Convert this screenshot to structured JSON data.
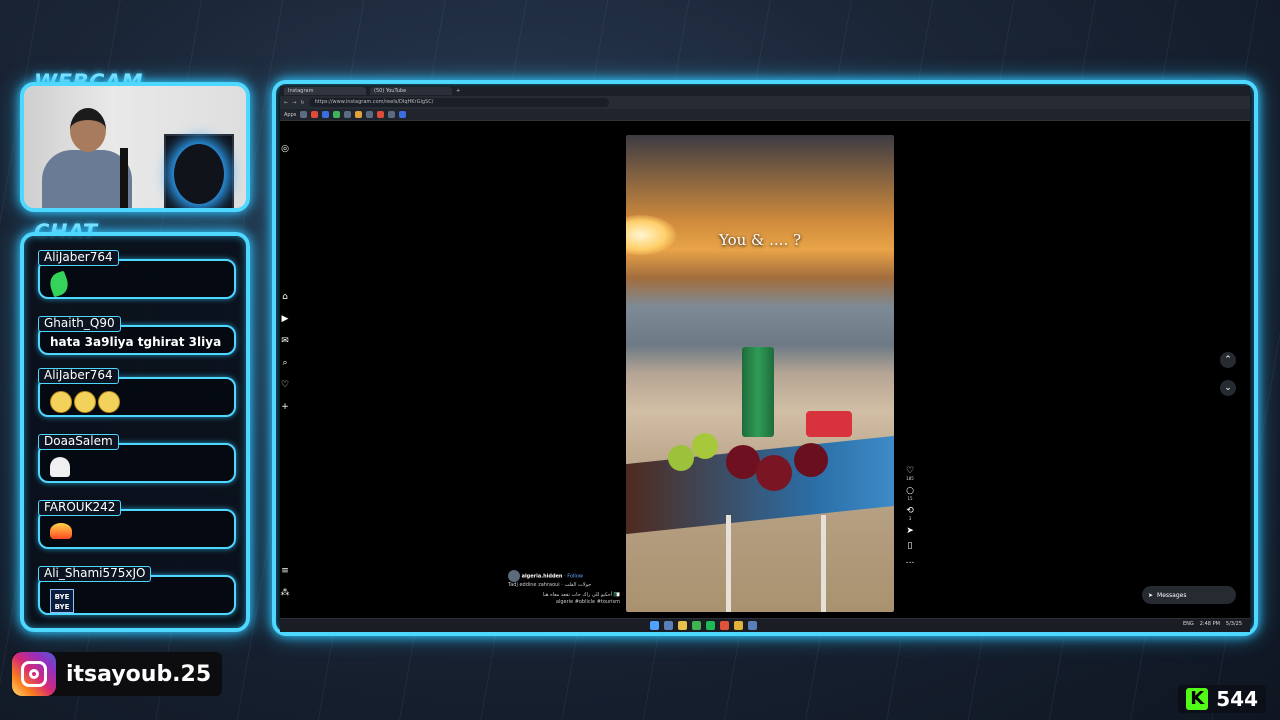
{
  "overlay": {
    "webcam_title": "WEBCAM",
    "chat_title": "CHAT",
    "social_handle": "itsayoub.25",
    "kick_count": "544"
  },
  "chat": [
    {
      "user": "AliJaber764",
      "text": "",
      "emote": "leaf"
    },
    {
      "user": "Ghaith_Q90",
      "text": "hata 3a9liya tghirat 3liya",
      "emote": ""
    },
    {
      "user": "AliJaber764",
      "text": "",
      "emote": "smileys"
    },
    {
      "user": "DoaaSalem",
      "text": "",
      "emote": "ghost"
    },
    {
      "user": "FAROUK242",
      "text": "",
      "emote": "fire"
    },
    {
      "user": "Ali_Shami575xJO",
      "text": "",
      "emote": "bye"
    }
  ],
  "browser": {
    "tabs": [
      "Instagram",
      "(50) YouTube"
    ],
    "url": "https://www.instagram.com/reels/DIqHKrGlgSC/",
    "apps_label": "Apps"
  },
  "reel": {
    "caption_overlay": "You & .... ?",
    "author": "algeria.hidden",
    "follow_label": "Follow",
    "audio": "Tadj eddine zahraoui · جولات القلب",
    "description": "أحكيو للي راك حاب تقعد معاه هنا 🇩🇿",
    "hashtags": "algerie #oblicle #tourism",
    "likes": "185",
    "comments": "15",
    "reposts": "3"
  },
  "ui": {
    "messages_label": "Messages",
    "time": "2:48 PM",
    "date": "5/3/25",
    "lang": "ENG"
  }
}
